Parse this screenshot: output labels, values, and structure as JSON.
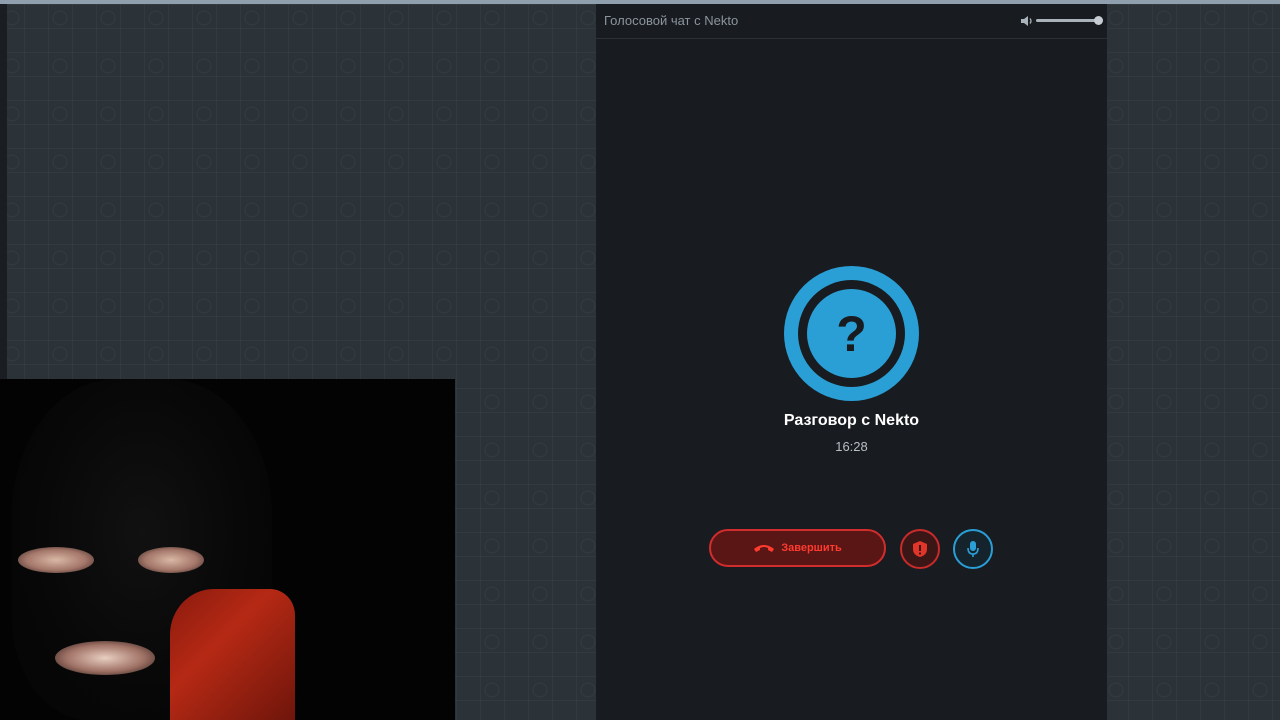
{
  "chat_header": {
    "title": "Голосовой чат с Nekto",
    "volume_level": 1.0
  },
  "call": {
    "avatar_symbol": "?",
    "name": "Разговор с Nekto",
    "timer": "16:28"
  },
  "controls": {
    "end_label": "Завершить",
    "end_icon": "phone-hangup-icon",
    "report_icon": "shield-alert-icon",
    "mic_icon": "microphone-icon"
  },
  "colors": {
    "accent": "#2a9fd6",
    "danger": "#d12d2d",
    "panel_bg": "#181c20"
  }
}
